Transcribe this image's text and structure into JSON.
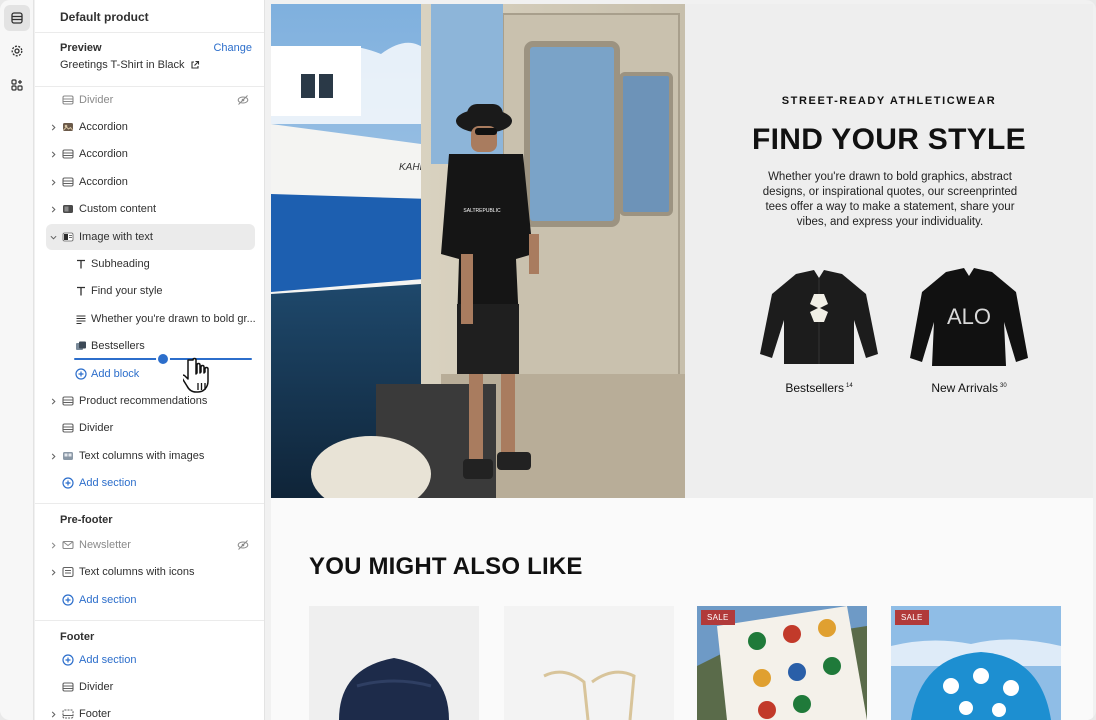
{
  "editor": {
    "title": "Default product",
    "preview_label": "Preview",
    "preview_value": "Greetings T-Shirt in Black",
    "change_label": "Change"
  },
  "template_rows": [
    {
      "label": "Divider",
      "icon": "section-icon",
      "hidden": true
    },
    {
      "label": "Accordion",
      "icon": "image-section-icon"
    },
    {
      "label": "Accordion",
      "icon": "section-icon"
    },
    {
      "label": "Accordion",
      "icon": "section-icon"
    },
    {
      "label": "Custom content",
      "icon": "image-section-icon"
    },
    {
      "label": "Image with text",
      "icon": "image-section-icon",
      "expanded": true,
      "selected": true
    }
  ],
  "image_with_text_blocks": [
    {
      "label": "Subheading",
      "icon": "text-icon"
    },
    {
      "label": "Find your style",
      "icon": "text-icon"
    },
    {
      "label": "Whether you're drawn to bold gr...",
      "icon": "paragraph-icon"
    },
    {
      "label": "Bestsellers",
      "icon": "collection-icon"
    }
  ],
  "add_block_label": "Add block",
  "template_rows_after": [
    {
      "label": "Product recommendations",
      "icon": "section-icon"
    },
    {
      "label": "Divider",
      "icon": "section-icon"
    },
    {
      "label": "Text columns with images",
      "icon": "image-section-icon"
    }
  ],
  "add_section_label": "Add section",
  "prefooter": {
    "heading": "Pre-footer",
    "rows": [
      {
        "label": "Newsletter",
        "icon": "email-icon",
        "hidden": true
      },
      {
        "label": "Text columns with icons",
        "icon": "section-icon"
      }
    ],
    "add_label": "Add section"
  },
  "footer": {
    "heading": "Footer",
    "add_label": "Add section",
    "rows": [
      {
        "label": "Divider",
        "icon": "section-icon"
      },
      {
        "label": "Footer",
        "icon": "footer-icon"
      }
    ]
  },
  "store_preview": {
    "subheading": "STREET-READY ATHLETICWEAR",
    "heading": "FIND YOUR STYLE",
    "body": "Whether you're drawn to bold graphics, abstract designs, or inspirational quotes, our screenprinted tees offer a way to make a statement, share your vibes, and express your individuality.",
    "collections": [
      {
        "label": "Bestsellers",
        "count": "14",
        "jacket_text": ""
      },
      {
        "label": "New Arrivals",
        "count": "30",
        "jacket_text": "ALO"
      }
    ],
    "recommendations_title": "YOU MIGHT ALSO LIKE",
    "sale_badge": "SALE",
    "boat_text": "KAHI",
    "shirt_text": "SALTREPUBLIC"
  },
  "colors": {
    "accent": "#2c6ecb",
    "sale": "#b13a3a"
  }
}
